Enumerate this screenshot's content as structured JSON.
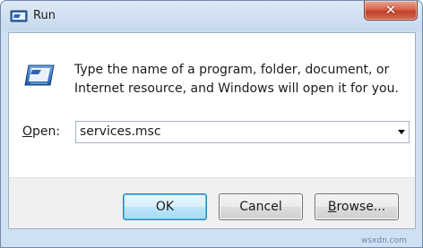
{
  "window": {
    "title": "Run",
    "close_glyph": "✕",
    "title_icon": "run-app-icon"
  },
  "dialog": {
    "icon": "run-icon",
    "description_line1": "Type the name of a program, folder, document, or",
    "description_line2": "Internet resource, and Windows will open it for you.",
    "open_label_accel": "O",
    "open_label_rest": "pen:",
    "open_value": "services.msc"
  },
  "buttons": {
    "ok_label": "OK",
    "cancel_label": "Cancel",
    "browse_label_accel": "B",
    "browse_label_rest": "rowse..."
  },
  "watermark": "wsxdn.com",
  "colors": {
    "frame": "#cfe0f3",
    "close_button": "#c14329",
    "default_button_border": "#3c7fb1"
  }
}
